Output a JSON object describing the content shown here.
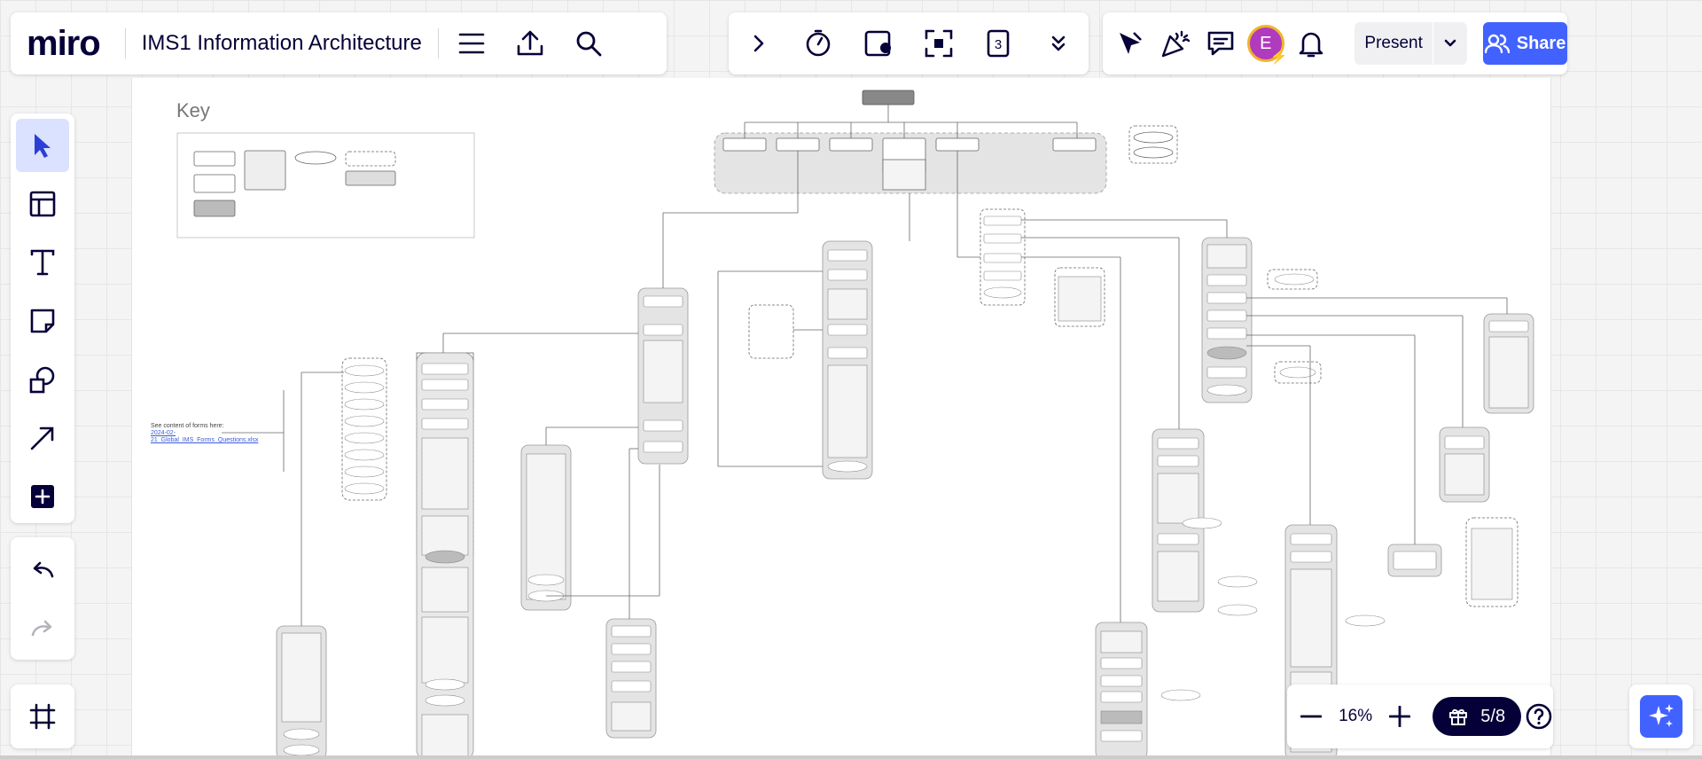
{
  "app": {
    "logo": "miro",
    "board_title": "IMS1 Information Architecture"
  },
  "header_right": {
    "avatar_initial": "E",
    "present_label": "Present",
    "share_label": "Share"
  },
  "zoom": {
    "level": "16%",
    "pages": "5/8"
  },
  "canvas": {
    "key_label": "Key",
    "side_note": "See content of forms here:",
    "side_note_link": "2024-02-21_Global_IMS_Forms_Questions.xlsx"
  },
  "colors": {
    "accent": "#4262ff",
    "dark": "#050038",
    "avatar": "#b03bbf",
    "avatar_ring": "#f0b429",
    "tool_active": "#dbe2ff"
  }
}
